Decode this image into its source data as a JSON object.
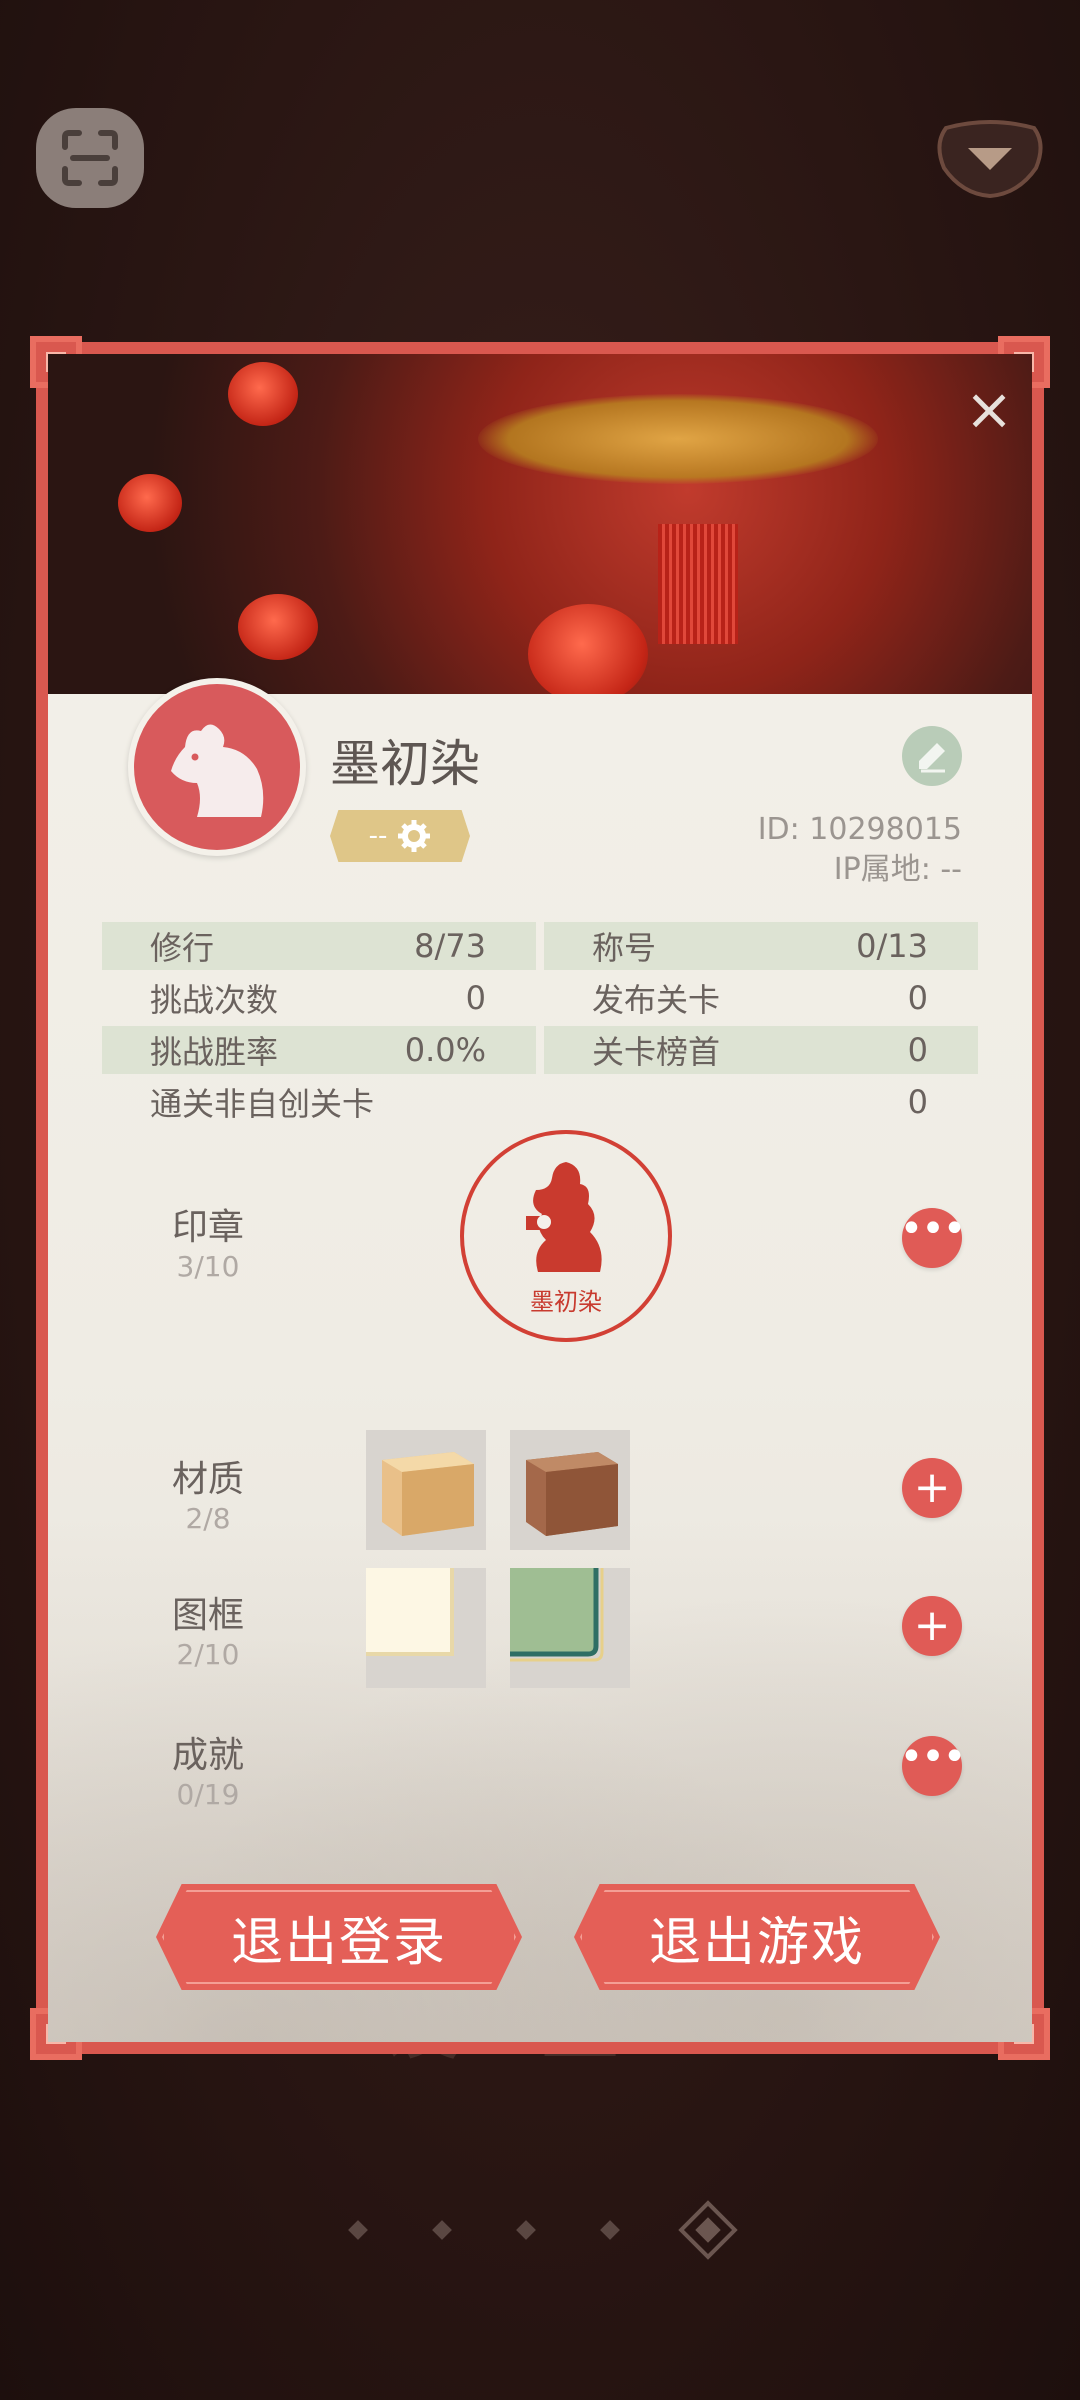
{
  "background": {
    "behind_text": "设置"
  },
  "profile": {
    "name": "墨初染",
    "title_badge": "--",
    "id_label": "ID: 10298015",
    "ip_label": "IP属地: --"
  },
  "stats": [
    {
      "l_label": "修行",
      "l_value": "8/73",
      "r_label": "称号",
      "r_value": "0/13"
    },
    {
      "l_label": "挑战次数",
      "l_value": "0",
      "r_label": "发布关卡",
      "r_value": "0"
    },
    {
      "l_label": "挑战胜率",
      "l_value": "0.0%",
      "r_label": "关卡榜首",
      "r_value": "0"
    },
    {
      "full_label": "通关非自创关卡",
      "full_value": "0"
    }
  ],
  "sections": {
    "seal": {
      "title": "印章",
      "count": "3/10",
      "seal_name": "墨初染"
    },
    "material": {
      "title": "材质",
      "count": "2/8"
    },
    "frame": {
      "title": "图框",
      "count": "2/10"
    },
    "achievement": {
      "title": "成就",
      "count": "0/19"
    }
  },
  "buttons": {
    "logout": "退出登录",
    "exit": "退出游戏"
  },
  "colors": {
    "accent": "#e05b56",
    "frame": "#d9584f",
    "stat_shade": "#dde3d3",
    "badge": "#dfc688"
  },
  "icons": [
    "scan-icon",
    "dropdown-icon",
    "close-icon",
    "rat-avatar-icon",
    "pencil-icon",
    "gear-icon",
    "seal-icon",
    "more-icon",
    "plus-icon"
  ]
}
